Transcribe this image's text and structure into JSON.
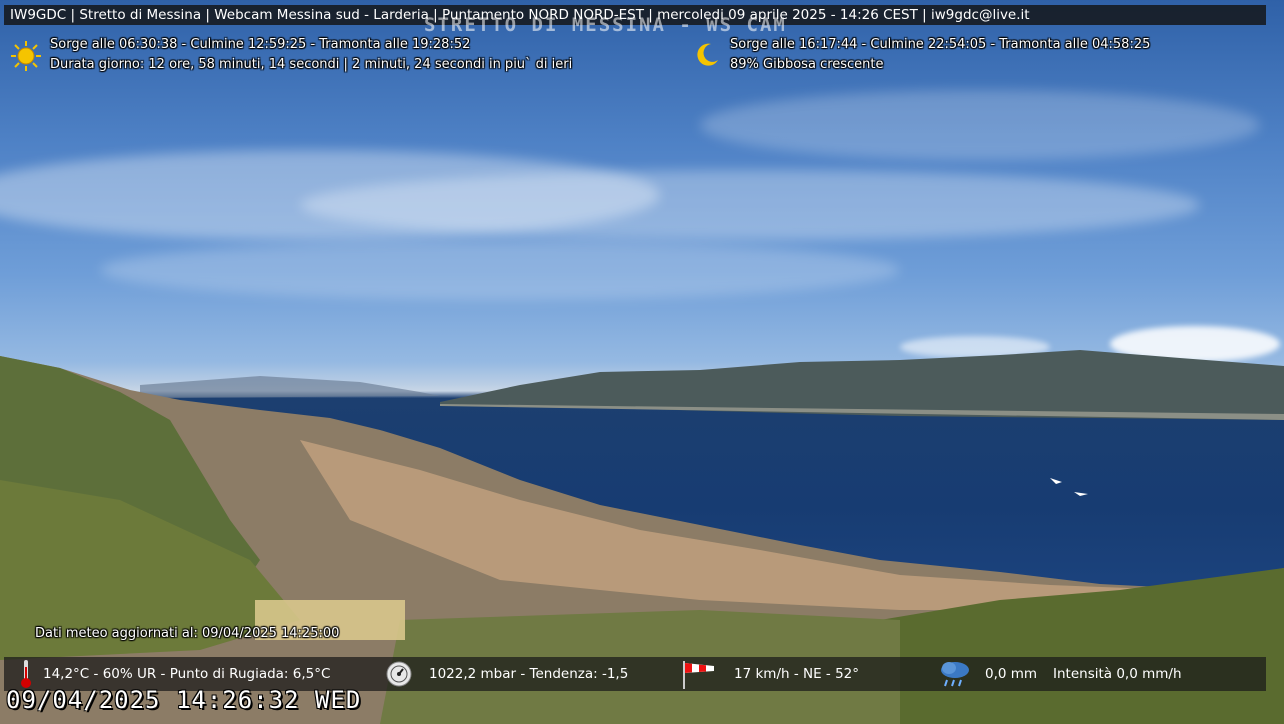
{
  "header": {
    "text": "IW9GDC | Stretto di Messina | Webcam Messina sud - Larderia | Puntamento NORD NORD-EST | mercoledi 09 aprile 2025 - 14:26 CEST | iw9gdc@live.it",
    "ghost_text": "STRETTO DI MESSINA - WS CAM"
  },
  "sun": {
    "icon": "sun-icon",
    "line1": "Sorge alle 06:30:38 - Culmine 12:59:25 - Tramonta alle 19:28:52",
    "line2": "Durata giorno: 12 ore, 58 minuti, 14 secondi | 2 minuti, 24 secondi in piu` di ieri"
  },
  "moon": {
    "icon": "crescent-moon-icon",
    "line1": "Sorge alle 16:17:44 - Culmine 22:54:05 - Tramonta alle 04:58:25",
    "line2": "89%  Gibbosa crescente"
  },
  "meteo": {
    "updated": "Dati meteo aggiornati al: 09/04/2025 14:25:00",
    "temperature": "14,2°C  -  60% UR  -  Punto di Rugiada: 6,5°C",
    "pressure": "1022,2 mbar  -  Tendenza: -1,5",
    "wind": "17 km/h  -  NE  -  52°",
    "rain": "0,0 mm",
    "rain_rate": "Intensità 0,0 mm/h",
    "icons": [
      "thermometer-icon",
      "barometer-icon",
      "windsock-icon",
      "rain-cloud-icon"
    ]
  },
  "clock": "09/04/2025 14:26:32 WED",
  "colors": {
    "sky_top": "#2f61a8",
    "sea": "#173c72",
    "bar_bg": "#141414",
    "sun": "#f5c400"
  }
}
